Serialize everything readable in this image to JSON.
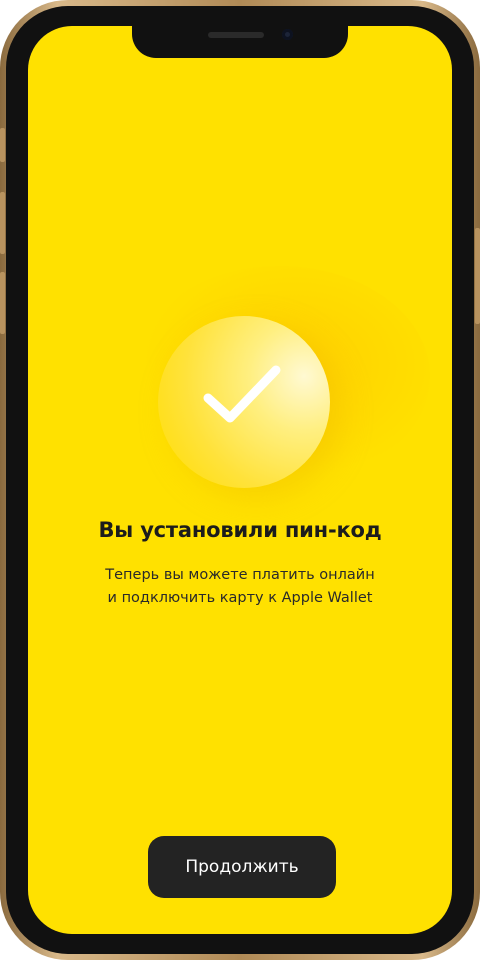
{
  "theme": {
    "accent": "#FFE100",
    "button_bg": "#232323",
    "button_text": "#FFFFFF"
  },
  "content": {
    "icon": "checkmark-icon",
    "title": "Вы установили пин-код",
    "subtitle_line1": "Теперь вы можете платить онлайн",
    "subtitle_line2": "и подключить карту к Apple Wallet"
  },
  "actions": {
    "continue_label": "Продолжить"
  }
}
